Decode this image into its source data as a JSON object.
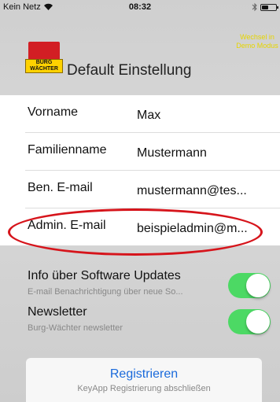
{
  "status_bar": {
    "carrier": "Kein Netz",
    "time": "08:32"
  },
  "header": {
    "logo_text_top": "BURG",
    "logo_text_bottom": "WÄCHTER",
    "title": "Default Einstellung",
    "demo_mode_label": "Wechsel in Demo Modus",
    "demo_mode_color": "#e6d500"
  },
  "form": {
    "rows": [
      {
        "label": "Vorname",
        "value": "Max"
      },
      {
        "label": "Familienname",
        "value": "Mustermann"
      },
      {
        "label": "Ben. E-mail",
        "value": "mustermann@tes..."
      },
      {
        "label": "Admin. E-mail",
        "value": "beispieladmin@m..."
      }
    ]
  },
  "toggles": [
    {
      "title": "Info über Software Updates",
      "subtitle": "E-mail Benachrichtigung über neue So...",
      "on": true
    },
    {
      "title": "Newsletter",
      "subtitle": "Burg-Wächter newsletter",
      "on": true
    }
  ],
  "register": {
    "label": "Registrieren",
    "subtitle": "KeyApp Registrierung abschließen",
    "accent": "#1a6adb"
  },
  "toggle_on_color": "#4cd964"
}
